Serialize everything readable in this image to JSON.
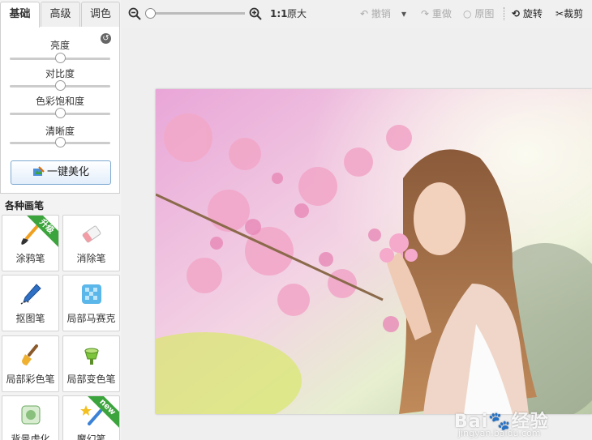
{
  "tabs": [
    {
      "label": "基础",
      "active": true
    },
    {
      "label": "高级",
      "active": false
    },
    {
      "label": "调色",
      "active": false
    }
  ],
  "sliders": [
    {
      "label": "亮度",
      "value": 0.5
    },
    {
      "label": "对比度",
      "value": 0.5
    },
    {
      "label": "色彩饱和度",
      "value": 0.5
    },
    {
      "label": "清晰度",
      "value": 0.5
    }
  ],
  "onekey_label": "一键美化",
  "brushes_title": "各种画笔",
  "tools": [
    {
      "label": "涂鸦笔",
      "icon": "paint-brush-icon",
      "ribbon": "升级"
    },
    {
      "label": "消除笔",
      "icon": "eraser-icon",
      "ribbon": ""
    },
    {
      "label": "抠图笔",
      "icon": "cutout-pen-icon",
      "ribbon": ""
    },
    {
      "label": "局部马赛克",
      "icon": "mosaic-icon",
      "ribbon": ""
    },
    {
      "label": "局部彩色笔",
      "icon": "color-brush-icon",
      "ribbon": ""
    },
    {
      "label": "局部变色笔",
      "icon": "color-change-icon",
      "ribbon": ""
    },
    {
      "label": "背景虚化",
      "icon": "background-blur-icon",
      "ribbon": ""
    },
    {
      "label": "魔幻笔",
      "icon": "magic-pen-icon",
      "ribbon": "new"
    }
  ],
  "toolbar": {
    "zoom_level": 0.0,
    "ratio_label": "1:1",
    "original_size_label": "原大",
    "undo_label": "撤销",
    "redo_label": "重做",
    "original_label": "原图",
    "rotate_label": "旋转",
    "crop_label": "裁剪"
  },
  "watermark": {
    "brand": "Bai",
    "brand2": "经验",
    "url": "jingyan.baidu.com"
  },
  "colors": {
    "accent": "#3ca43c",
    "button_border": "#7fa9d0"
  }
}
